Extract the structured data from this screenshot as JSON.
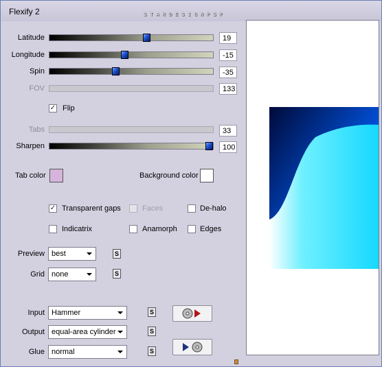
{
  "window": {
    "title": "Flexify 2",
    "brand": "STARDESIGNPSP"
  },
  "sliders": [
    {
      "label": "Latitude",
      "value": "19",
      "level": 0.6,
      "enabled": true
    },
    {
      "label": "Longitude",
      "value": "-15",
      "level": 0.46,
      "enabled": true
    },
    {
      "label": "Spin",
      "value": "-35",
      "level": 0.4,
      "enabled": true
    },
    {
      "label": "FOV",
      "value": "133",
      "enabled": false
    },
    {
      "label": "Tabs",
      "value": "33",
      "enabled": false
    },
    {
      "label": "Sharpen",
      "value": "100",
      "level": 1.0,
      "enabled": true
    }
  ],
  "flip": {
    "label": "Flip",
    "checked": true
  },
  "tab_color": {
    "label": "Tab color",
    "color": "#d6b4dc"
  },
  "background_color": {
    "label": "Background color",
    "color": "#ffffff"
  },
  "checkboxes": {
    "transparent_gaps": {
      "label": "Transparent gaps",
      "checked": true
    },
    "faces": {
      "label": "Faces",
      "checked": false,
      "enabled": false
    },
    "de_halo": {
      "label": "De-halo",
      "checked": false
    },
    "indicatrix": {
      "label": "Indicatrix",
      "checked": false
    },
    "anamorph": {
      "label": "Anamorph",
      "checked": false
    },
    "edges": {
      "label": "Edges",
      "checked": false
    }
  },
  "dropdowns": {
    "preview": {
      "label": "Preview",
      "value": "best"
    },
    "grid": {
      "label": "Grid",
      "value": "none"
    },
    "input": {
      "label": "Input",
      "value": "Hammer"
    },
    "output": {
      "label": "Output",
      "value": "equal-area cylinder"
    },
    "glue": {
      "label": "Glue",
      "value": "normal"
    }
  },
  "s_button_label": "S",
  "icons": [
    "load-preset-icon",
    "save-preset-icon",
    "checkmark-icon",
    "chevron-down-icon"
  ]
}
